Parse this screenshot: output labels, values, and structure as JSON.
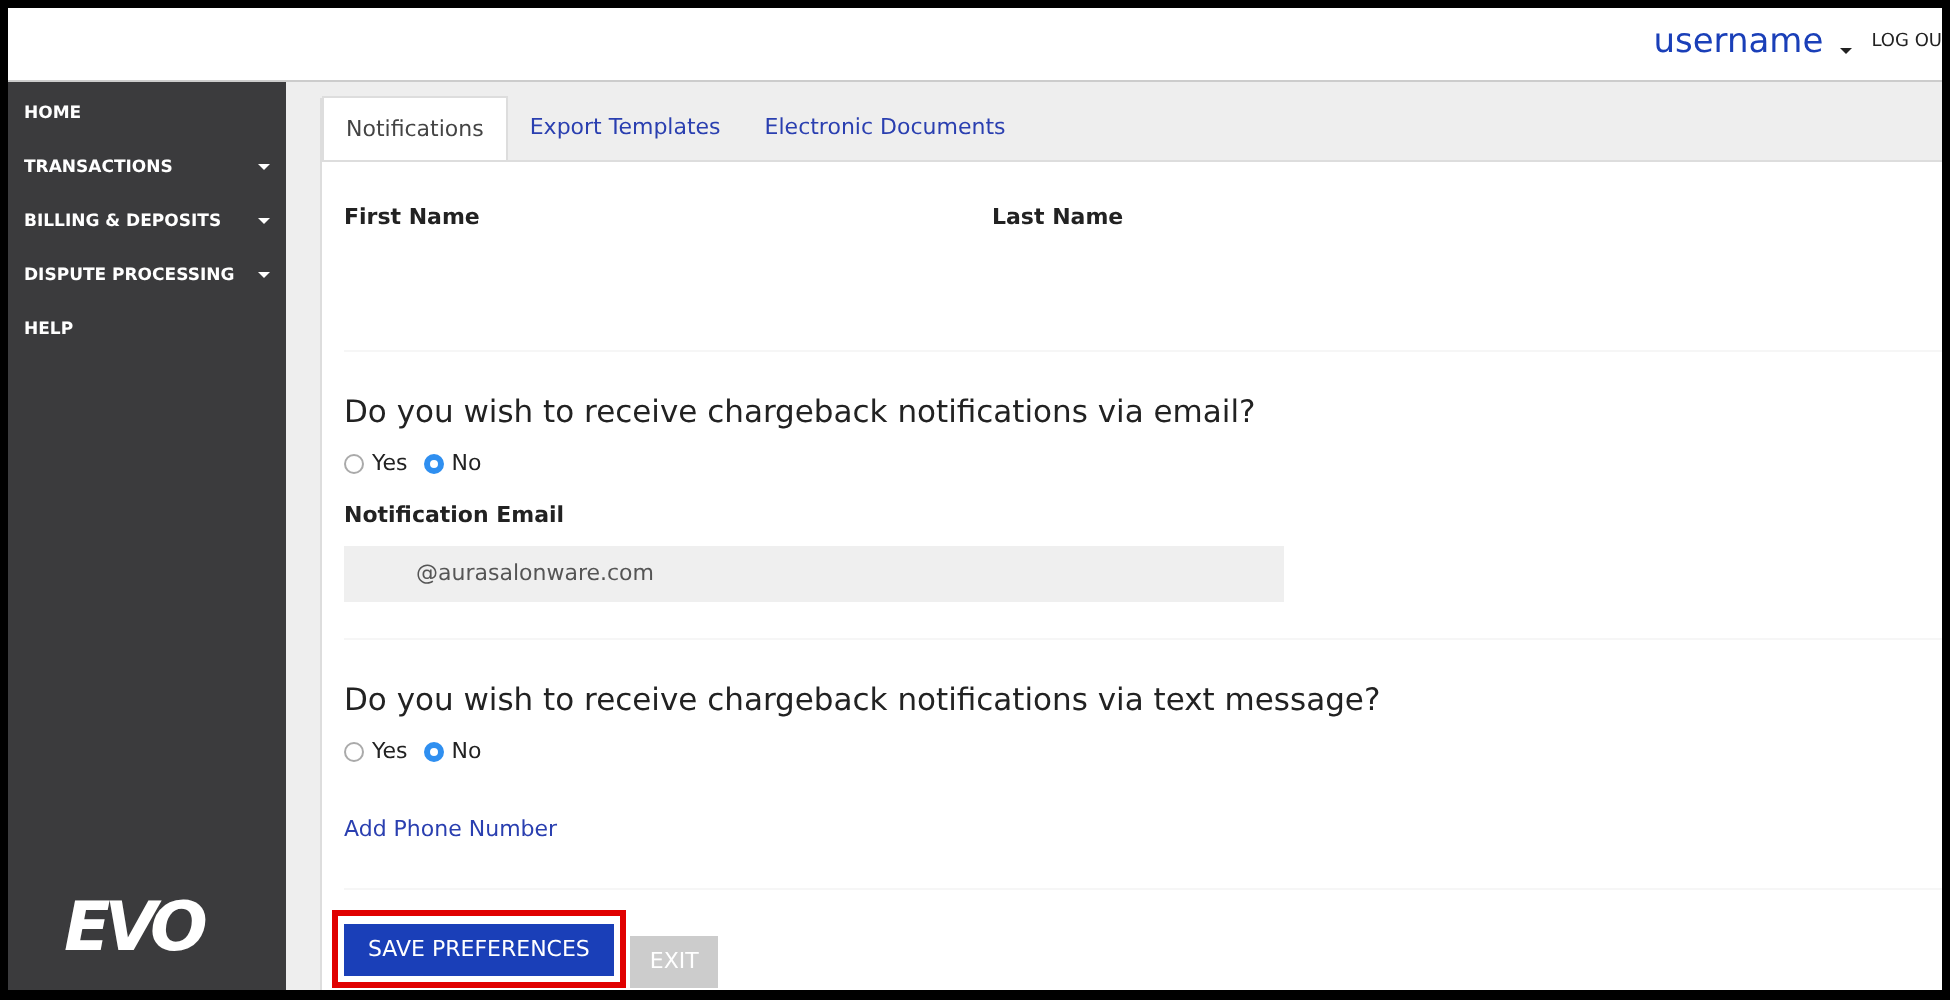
{
  "header": {
    "username": "username",
    "logout": "LOG OU"
  },
  "sidebar": {
    "items": [
      {
        "label": "HOME",
        "expandable": false
      },
      {
        "label": "TRANSACTIONS",
        "expandable": true
      },
      {
        "label": "BILLING & DEPOSITS",
        "expandable": true
      },
      {
        "label": "DISPUTE PROCESSING",
        "expandable": true
      },
      {
        "label": "HELP",
        "expandable": false
      }
    ],
    "logo": "EVO"
  },
  "tabs": [
    {
      "label": "Notifications",
      "selected": true
    },
    {
      "label": "Export Templates",
      "selected": false
    },
    {
      "label": "Electronic Documents",
      "selected": false
    }
  ],
  "name_fields": [
    "First Name",
    "Last Name"
  ],
  "sections": [
    {
      "question": "Do you wish to receive chargeback notifications via email?",
      "options": [
        {
          "label": "Yes",
          "selected": false
        },
        {
          "label": "No",
          "selected": true
        }
      ],
      "field_label": "Notification Email",
      "field_value": "@aurasalonware.com"
    },
    {
      "question": "Do you wish to receive chargeback notifications via text message?",
      "options": [
        {
          "label": "Yes",
          "selected": false
        },
        {
          "label": "No",
          "selected": true
        }
      ],
      "link": "Add Phone Number"
    }
  ],
  "buttons": [
    {
      "label": "SAVE PREFERENCES",
      "kind": "primary",
      "highlighted": true
    },
    {
      "label": "EXIT",
      "kind": "secondary",
      "highlighted": false
    }
  ]
}
